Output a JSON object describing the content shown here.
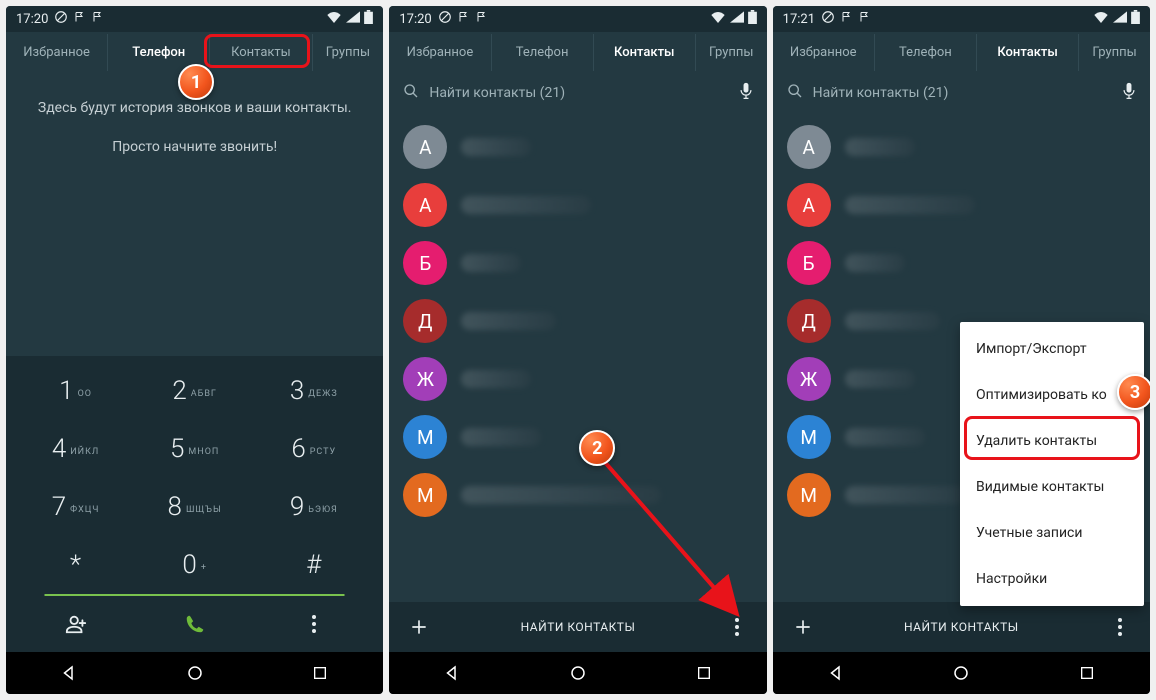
{
  "screen1": {
    "statusTime": "17:20",
    "tabs": {
      "fav": "Избранное",
      "phone": "Телефон",
      "contacts": "Контакты",
      "groups": "Группы"
    },
    "empty": {
      "line1": "Здесь будут история звонков и ваши контакты.",
      "line2": "Просто начните звонить!"
    },
    "dial": {
      "k1": {
        "d": "1",
        "l": "ОО"
      },
      "k2": {
        "d": "2",
        "l": "АБВГ"
      },
      "k3": {
        "d": "3",
        "l": "ДЕЖЗ"
      },
      "k4": {
        "d": "4",
        "l": "ИЙКЛ"
      },
      "k5": {
        "d": "5",
        "l": "МНОП"
      },
      "k6": {
        "d": "6",
        "l": "РСТУ"
      },
      "k7": {
        "d": "7",
        "l": "ФХЦЧ"
      },
      "k8": {
        "d": "8",
        "l": "ШЩЪЫ"
      },
      "k9": {
        "d": "9",
        "l": "ЬЭЮЯ"
      },
      "kstar": {
        "d": "*"
      },
      "k0": {
        "d": "0",
        "l": "+"
      },
      "khash": {
        "d": "#"
      }
    },
    "stepLabel": "1"
  },
  "screen2": {
    "statusTime": "17:20",
    "tabs": {
      "fav": "Избранное",
      "phone": "Телефон",
      "contacts": "Контакты",
      "groups": "Группы"
    },
    "search": "Найти контакты (21)",
    "contacts": [
      {
        "letter": "А",
        "color": "c-grey"
      },
      {
        "letter": "А",
        "color": "c-red"
      },
      {
        "letter": "Б",
        "color": "c-pink"
      },
      {
        "letter": "Д",
        "color": "c-maroon"
      },
      {
        "letter": "Ж",
        "color": "c-purple"
      },
      {
        "letter": "М",
        "color": "c-blue"
      },
      {
        "letter": "М",
        "color": "c-orange"
      }
    ],
    "bottomLabel": "НАЙТИ КОНТАКТЫ",
    "stepLabel": "2"
  },
  "screen3": {
    "statusTime": "17:21",
    "tabs": {
      "fav": "Избранное",
      "phone": "Телефон",
      "contacts": "Контакты",
      "groups": "Группы"
    },
    "search": "Найти контакты (21)",
    "contacts": [
      {
        "letter": "А",
        "color": "c-grey"
      },
      {
        "letter": "А",
        "color": "c-red"
      },
      {
        "letter": "Б",
        "color": "c-pink"
      },
      {
        "letter": "Д",
        "color": "c-maroon"
      },
      {
        "letter": "Ж",
        "color": "c-purple"
      },
      {
        "letter": "М",
        "color": "c-blue"
      },
      {
        "letter": "М",
        "color": "c-orange"
      }
    ],
    "bottomLabel": "НАЙТИ КОНТАКТЫ",
    "menu": {
      "importExport": "Импорт/Экспорт",
      "optimize": "Оптимизировать ко",
      "delete": "Удалить контакты",
      "visible": "Видимые контакты",
      "accounts": "Учетные записи",
      "settings": "Настройки"
    },
    "stepLabel": "3"
  }
}
